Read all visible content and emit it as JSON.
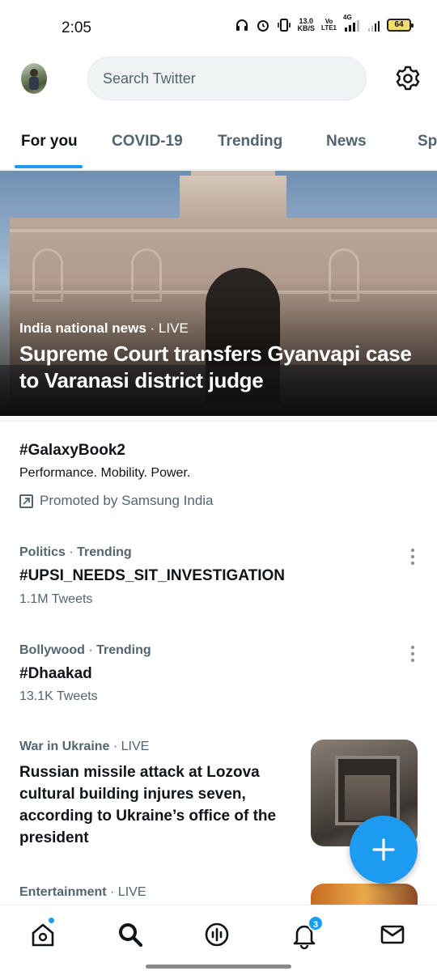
{
  "status_bar": {
    "time": "2:05",
    "net_speed_value": "13.0",
    "net_speed_unit": "KB/S",
    "volte_top": "Vo",
    "volte_bottom": "LTE1",
    "network": "4G",
    "battery": "64"
  },
  "header": {
    "search_placeholder": "Search Twitter"
  },
  "tabs": [
    {
      "label": "For you"
    },
    {
      "label": "COVID-19"
    },
    {
      "label": "Trending"
    },
    {
      "label": "News"
    },
    {
      "label": "Sp"
    }
  ],
  "hero": {
    "category": "India national news",
    "status": "LIVE",
    "title": "Supreme Court transfers Gyanvapi case to Varanasi district judge"
  },
  "promoted": {
    "hashtag": "#GalaxyBook2",
    "description": "Performance. Mobility. Power.",
    "promoted_by": "Promoted by Samsung India"
  },
  "trends": [
    {
      "category": "Politics",
      "label": "Trending",
      "name": "#UPSI_NEEDS_SIT_INVESTIGATION",
      "count": "1.1M Tweets"
    },
    {
      "category": "Bollywood",
      "label": "Trending",
      "name": "#Dhaakad",
      "count": "13.1K Tweets"
    }
  ],
  "news": {
    "category": "War in Ukraine",
    "status": "LIVE",
    "title": "Russian missile attack at Lozova cultural building injures seven, according to Ukraine’s office of the president"
  },
  "entertainment": {
    "category": "Entertainment",
    "status": "LIVE"
  },
  "bottom_nav": {
    "notifications_badge": "3"
  },
  "colors": {
    "accent": "#1d9bf0",
    "text_primary": "#0f1419",
    "text_secondary": "#536471"
  },
  "icons": [
    "headphones-icon",
    "alarm-icon",
    "vibrate-icon",
    "signal-icon",
    "battery-icon",
    "gear-icon",
    "external-link-icon",
    "more-vertical-icon",
    "plus-icon",
    "home-icon",
    "search-icon",
    "spaces-icon",
    "bell-icon",
    "mail-icon"
  ]
}
